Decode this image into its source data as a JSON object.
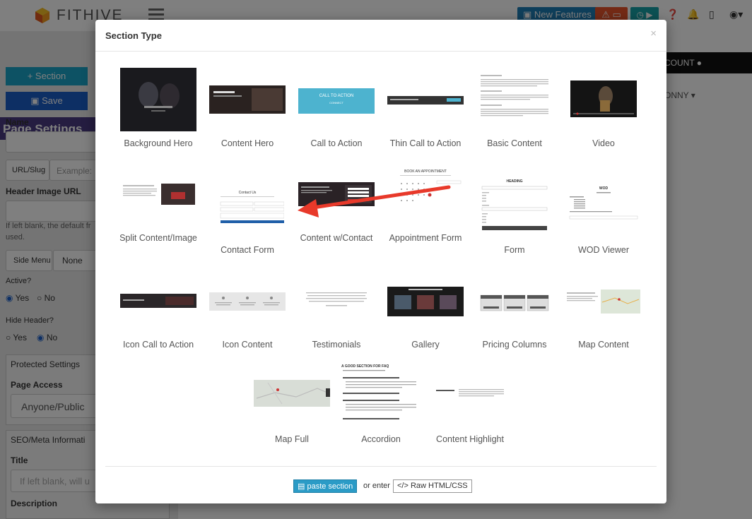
{
  "app": {
    "brand": "FITHIVE",
    "new_features": "New Features",
    "account": "COUNT",
    "user": "ONNY"
  },
  "left_panel": {
    "section_btn": "Section",
    "save_btn": "Save",
    "page_settings": "Page Settings",
    "name_label": "Name",
    "url_slug_label": "URL/Slug",
    "url_placeholder": "Example: ",
    "header_image_label": "Header Image URL",
    "header_hint_1": "If left blank, the default fr",
    "header_hint_2": "used.",
    "side_menu_label": "Side Menu",
    "side_menu_value": "None",
    "active_label": "Active?",
    "hide_header_label": "Hide Header?",
    "yes": "Yes",
    "no": "No",
    "protected_settings": "Protected Settings",
    "page_access_label": "Page Access",
    "page_access_value": "Anyone/Public",
    "seo_label": "SEO/Meta Informati",
    "title_label": "Title",
    "title_placeholder": "If left blank, will u",
    "description_label": "Description"
  },
  "modal": {
    "title": "Section Type",
    "close": "×",
    "tiles": [
      {
        "label": "Background Hero"
      },
      {
        "label": "Content Hero"
      },
      {
        "label": "Call to Action"
      },
      {
        "label": "Thin Call to Action"
      },
      {
        "label": "Basic Content"
      },
      {
        "label": "Video"
      },
      {
        "label": "Split Content/Image"
      },
      {
        "label": "Contact Form"
      },
      {
        "label": "Content w/Contact"
      },
      {
        "label": "Appointment Form"
      },
      {
        "label": "Form"
      },
      {
        "label": "WOD Viewer"
      },
      {
        "label": "Icon Call to Action"
      },
      {
        "label": "Icon Content"
      },
      {
        "label": "Testimonials"
      },
      {
        "label": "Gallery"
      },
      {
        "label": "Pricing Columns"
      },
      {
        "label": "Map Content"
      },
      {
        "label": "Map Full"
      },
      {
        "label": "Accordion"
      },
      {
        "label": "Content Highlight"
      }
    ],
    "thumbs": {
      "cta_text": "CALL TO ACTION",
      "cta_sub": "CONNECT",
      "contact_title": "Contact Us",
      "appointment_title": "BOOK AN APPOINTMENT",
      "form_heading": "HEADING",
      "wod_title": "WOD",
      "accordion_title": "A GOOD SECTION FOR FAQ"
    },
    "paste_section": "paste section",
    "or_enter": "or enter",
    "raw_html": "Raw HTML/CSS"
  },
  "colors": {
    "overlay": "#000000",
    "paste_button": "#2b9bc6",
    "arrow": "#e8392a",
    "cta_block": "#4db3cf"
  }
}
